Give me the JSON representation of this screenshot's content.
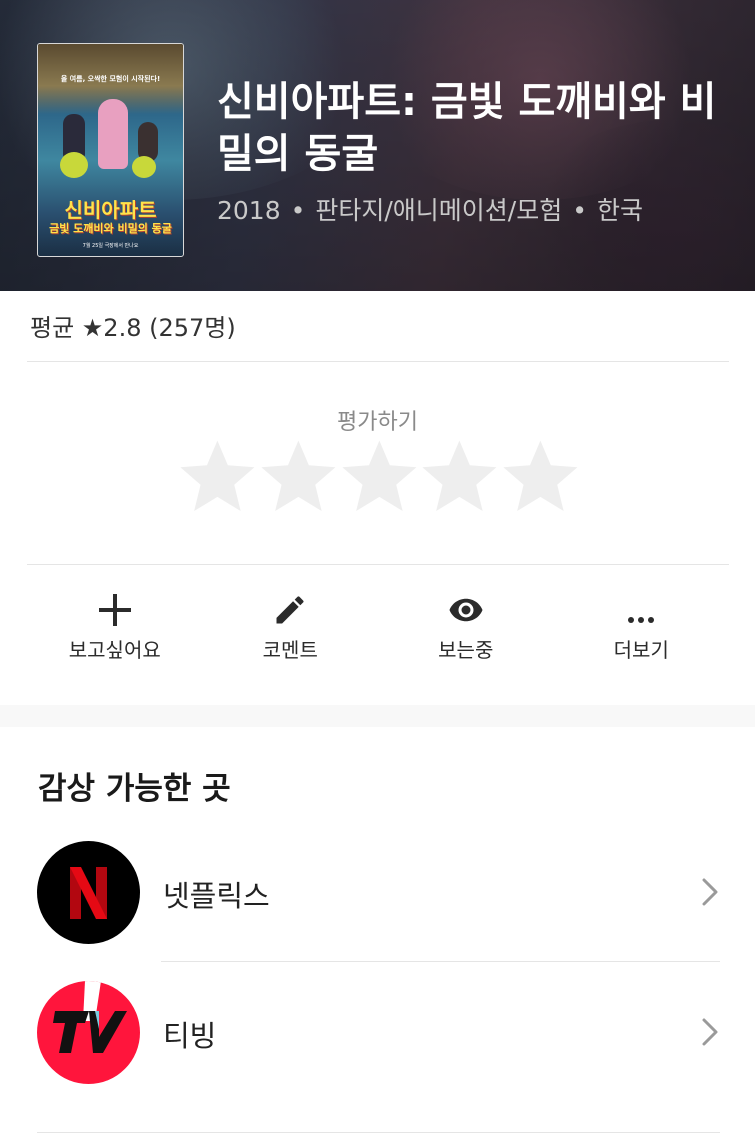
{
  "movie": {
    "title": "신비아파트: 금빛 도깨비와 비밀의 동굴",
    "year": "2018",
    "genres": "판타지/애니메이션/모험",
    "country": "한국",
    "separator": "•"
  },
  "poster": {
    "tagline": "올 여름, 오싹한 모험이 시작된다!",
    "logo_main": "신비아파트",
    "logo_sub": "금빛 도깨비와 비밀의 동굴",
    "release_text": "7월 25일 극장에서 만나요"
  },
  "rating": {
    "average_text": "평균 ★2.8 (257명)",
    "rate_label": "평가하기",
    "star_count": 5,
    "user_rating": 0,
    "star_color": "#eeeeee"
  },
  "actions": [
    {
      "label": "보고싶어요",
      "icon": "plus-icon"
    },
    {
      "label": "코멘트",
      "icon": "pencil-icon"
    },
    {
      "label": "보는중",
      "icon": "eye-icon"
    },
    {
      "label": "더보기",
      "icon": "more-dots-icon"
    }
  ],
  "watch": {
    "section_title": "감상 가능한 곳",
    "providers": [
      {
        "name": "넷플릭스",
        "logo": "netflix-logo",
        "bg": "#000000",
        "accent": "#e50914"
      },
      {
        "name": "티빙",
        "logo": "tving-logo",
        "bg": "#ff153c",
        "accent": "#111111"
      }
    ]
  }
}
